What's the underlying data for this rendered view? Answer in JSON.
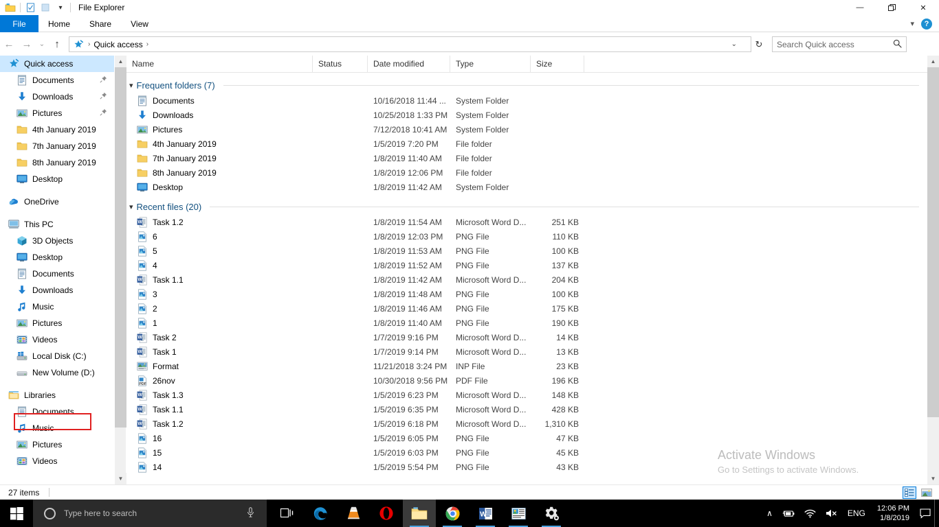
{
  "window": {
    "title": "File Explorer",
    "quick_access_toolbar": [
      "folder-icon",
      "properties-icon",
      "new-folder-icon",
      "customize-dropdown-icon"
    ],
    "controls": {
      "minimize": "—",
      "maximize": "❐",
      "close": "✕"
    }
  },
  "ribbon": {
    "tabs": [
      {
        "label": "File",
        "active": true
      },
      {
        "label": "Home",
        "active": false
      },
      {
        "label": "Share",
        "active": false
      },
      {
        "label": "View",
        "active": false
      }
    ],
    "collapse_icon": "chevron-down-icon",
    "help_label": "?"
  },
  "addressbar": {
    "back_icon": "←",
    "forward_icon": "→",
    "recent_icon": "⌄",
    "up_icon": "↑",
    "breadcrumb": [
      "Quick access"
    ],
    "breadcrumb_icon": "quick-access-star-icon",
    "separator": "›",
    "dropdown_icon": "⌄",
    "refresh_icon": "↻"
  },
  "search": {
    "placeholder": "Search Quick access",
    "value": "",
    "icon": "search-icon"
  },
  "sidebar": {
    "items": [
      {
        "label": "Quick access",
        "icon": "quick-access-star-icon",
        "indent": 0,
        "selected": true,
        "pinned": false,
        "gap_before": false
      },
      {
        "label": "Documents",
        "icon": "documents-icon",
        "indent": 1,
        "selected": false,
        "pinned": true,
        "gap_before": false
      },
      {
        "label": "Downloads",
        "icon": "downloads-icon",
        "indent": 1,
        "selected": false,
        "pinned": true,
        "gap_before": false
      },
      {
        "label": "Pictures",
        "icon": "pictures-icon",
        "indent": 1,
        "selected": false,
        "pinned": true,
        "gap_before": false
      },
      {
        "label": "4th January 2019",
        "icon": "folder-icon",
        "indent": 1,
        "selected": false,
        "pinned": false,
        "gap_before": false
      },
      {
        "label": "7th January 2019",
        "icon": "folder-icon",
        "indent": 1,
        "selected": false,
        "pinned": false,
        "gap_before": false
      },
      {
        "label": "8th January 2019",
        "icon": "folder-icon",
        "indent": 1,
        "selected": false,
        "pinned": false,
        "gap_before": false
      },
      {
        "label": "Desktop",
        "icon": "desktop-icon",
        "indent": 1,
        "selected": false,
        "pinned": false,
        "gap_before": false
      },
      {
        "label": "OneDrive",
        "icon": "onedrive-cloud-icon",
        "indent": 0,
        "selected": false,
        "pinned": false,
        "gap_before": true
      },
      {
        "label": "This PC",
        "icon": "this-pc-icon",
        "indent": 0,
        "selected": false,
        "pinned": false,
        "gap_before": true
      },
      {
        "label": "3D Objects",
        "icon": "3d-objects-icon",
        "indent": 1,
        "selected": false,
        "pinned": false,
        "gap_before": false
      },
      {
        "label": "Desktop",
        "icon": "desktop-icon",
        "indent": 1,
        "selected": false,
        "pinned": false,
        "gap_before": false
      },
      {
        "label": "Documents",
        "icon": "documents-icon",
        "indent": 1,
        "selected": false,
        "pinned": false,
        "gap_before": false
      },
      {
        "label": "Downloads",
        "icon": "downloads-icon",
        "indent": 1,
        "selected": false,
        "pinned": false,
        "gap_before": false
      },
      {
        "label": "Music",
        "icon": "music-note-icon",
        "indent": 1,
        "selected": false,
        "pinned": false,
        "gap_before": false
      },
      {
        "label": "Pictures",
        "icon": "pictures-icon",
        "indent": 1,
        "selected": false,
        "pinned": false,
        "gap_before": false
      },
      {
        "label": "Videos",
        "icon": "videos-icon",
        "indent": 1,
        "selected": false,
        "pinned": false,
        "gap_before": false
      },
      {
        "label": "Local Disk (C:)",
        "icon": "windows-drive-icon",
        "indent": 1,
        "selected": false,
        "pinned": false,
        "gap_before": false,
        "highlighted": true
      },
      {
        "label": "New Volume (D:)",
        "icon": "drive-icon",
        "indent": 1,
        "selected": false,
        "pinned": false,
        "gap_before": false
      },
      {
        "label": "Libraries",
        "icon": "libraries-icon",
        "indent": 0,
        "selected": false,
        "pinned": false,
        "gap_before": true
      },
      {
        "label": "Documents",
        "icon": "documents-icon",
        "indent": 1,
        "selected": false,
        "pinned": false,
        "gap_before": false
      },
      {
        "label": "Music",
        "icon": "music-note-icon",
        "indent": 1,
        "selected": false,
        "pinned": false,
        "gap_before": false
      },
      {
        "label": "Pictures",
        "icon": "pictures-icon",
        "indent": 1,
        "selected": false,
        "pinned": false,
        "gap_before": false
      },
      {
        "label": "Videos",
        "icon": "videos-icon",
        "indent": 1,
        "selected": false,
        "pinned": false,
        "gap_before": false
      }
    ]
  },
  "filelist": {
    "columns": [
      {
        "label": "Name"
      },
      {
        "label": "Status"
      },
      {
        "label": "Date modified"
      },
      {
        "label": "Type"
      },
      {
        "label": "Size"
      }
    ],
    "groups": [
      {
        "header": "Frequent folders (7)",
        "chevron": "⌄",
        "rows": [
          {
            "name": "Documents",
            "icon": "documents-icon",
            "date": "10/16/2018 11:44 ...",
            "type": "System Folder",
            "size": ""
          },
          {
            "name": "Downloads",
            "icon": "downloads-icon",
            "date": "10/25/2018 1:33 PM",
            "type": "System Folder",
            "size": ""
          },
          {
            "name": "Pictures",
            "icon": "pictures-icon",
            "date": "7/12/2018 10:41 AM",
            "type": "System Folder",
            "size": ""
          },
          {
            "name": "4th January 2019",
            "icon": "folder-icon",
            "date": "1/5/2019 7:20 PM",
            "type": "File folder",
            "size": ""
          },
          {
            "name": "7th January 2019",
            "icon": "folder-icon",
            "date": "1/8/2019 11:40 AM",
            "type": "File folder",
            "size": ""
          },
          {
            "name": "8th January 2019",
            "icon": "folder-icon",
            "date": "1/8/2019 12:06 PM",
            "type": "File folder",
            "size": ""
          },
          {
            "name": "Desktop",
            "icon": "desktop-icon",
            "date": "1/8/2019 11:42 AM",
            "type": "System Folder",
            "size": ""
          }
        ]
      },
      {
        "header": "Recent files (20)",
        "chevron": "⌄",
        "rows": [
          {
            "name": "Task 1.2",
            "icon": "word-doc-icon",
            "date": "1/8/2019 11:54 AM",
            "type": "Microsoft Word D...",
            "size": "251 KB"
          },
          {
            "name": "6",
            "icon": "png-file-icon",
            "date": "1/8/2019 12:03 PM",
            "type": "PNG File",
            "size": "110 KB"
          },
          {
            "name": "5",
            "icon": "png-file-icon",
            "date": "1/8/2019 11:53 AM",
            "type": "PNG File",
            "size": "100 KB"
          },
          {
            "name": "4",
            "icon": "png-file-icon",
            "date": "1/8/2019 11:52 AM",
            "type": "PNG File",
            "size": "137 KB"
          },
          {
            "name": "Task 1.1",
            "icon": "word-doc-icon",
            "date": "1/8/2019 11:42 AM",
            "type": "Microsoft Word D...",
            "size": "204 KB"
          },
          {
            "name": "3",
            "icon": "png-file-icon",
            "date": "1/8/2019 11:48 AM",
            "type": "PNG File",
            "size": "100 KB"
          },
          {
            "name": "2",
            "icon": "png-file-icon",
            "date": "1/8/2019 11:46 AM",
            "type": "PNG File",
            "size": "175 KB"
          },
          {
            "name": "1",
            "icon": "png-file-icon",
            "date": "1/8/2019 11:40 AM",
            "type": "PNG File",
            "size": "190 KB"
          },
          {
            "name": "Task 2",
            "icon": "word-doc-icon",
            "date": "1/7/2019 9:16 PM",
            "type": "Microsoft Word D...",
            "size": "14 KB"
          },
          {
            "name": "Task 1",
            "icon": "word-doc-icon",
            "date": "1/7/2019 9:14 PM",
            "type": "Microsoft Word D...",
            "size": "13 KB"
          },
          {
            "name": "Format",
            "icon": "inp-file-icon",
            "date": "11/21/2018 3:24 PM",
            "type": "INP File",
            "size": "23 KB"
          },
          {
            "name": "26nov",
            "icon": "pdf-file-icon",
            "date": "10/30/2018 9:56 PM",
            "type": "PDF File",
            "size": "196 KB"
          },
          {
            "name": "Task 1.3",
            "icon": "word-doc-icon",
            "date": "1/5/2019 6:23 PM",
            "type": "Microsoft Word D...",
            "size": "148 KB"
          },
          {
            "name": "Task 1.1",
            "icon": "word-doc-icon",
            "date": "1/5/2019 6:35 PM",
            "type": "Microsoft Word D...",
            "size": "428 KB"
          },
          {
            "name": "Task 1.2",
            "icon": "word-doc-icon",
            "date": "1/5/2019 6:18 PM",
            "type": "Microsoft Word D...",
            "size": "1,310 KB"
          },
          {
            "name": "16",
            "icon": "png-file-icon",
            "date": "1/5/2019 6:05 PM",
            "type": "PNG File",
            "size": "47 KB"
          },
          {
            "name": "15",
            "icon": "png-file-icon",
            "date": "1/5/2019 6:03 PM",
            "type": "PNG File",
            "size": "45 KB"
          },
          {
            "name": "14",
            "icon": "png-file-icon",
            "date": "1/5/2019 5:54 PM",
            "type": "PNG File",
            "size": "43 KB"
          }
        ]
      }
    ]
  },
  "watermark": {
    "line1": "Activate Windows",
    "line2": "Go to Settings to activate Windows."
  },
  "statusbar": {
    "item_count": "27 items",
    "views": [
      {
        "name": "details-view",
        "active": true
      },
      {
        "name": "large-icons-view",
        "active": false
      }
    ]
  },
  "taskbar": {
    "start_label": "start-button",
    "search_placeholder": "Type here to search",
    "search_value": "",
    "cortana_icon": "cortana-circle-icon",
    "mic_icon": "microphone-icon",
    "apps": [
      {
        "name": "task-view",
        "icon": "task-view-icon",
        "running": false,
        "active": false
      },
      {
        "name": "microsoft-edge",
        "icon": "edge-icon",
        "running": false,
        "active": false
      },
      {
        "name": "vlc-media-player",
        "icon": "vlc-cone-icon",
        "running": false,
        "active": false
      },
      {
        "name": "opera-browser",
        "icon": "opera-icon",
        "running": false,
        "active": false
      },
      {
        "name": "file-explorer",
        "icon": "file-explorer-icon",
        "running": true,
        "active": true
      },
      {
        "name": "google-chrome",
        "icon": "chrome-icon",
        "running": true,
        "active": false
      },
      {
        "name": "microsoft-word",
        "icon": "word-icon",
        "running": true,
        "active": false
      },
      {
        "name": "microsoft-publisher",
        "icon": "publisher-icon",
        "running": true,
        "active": false
      },
      {
        "name": "settings",
        "icon": "settings-gear-icon",
        "running": true,
        "active": false
      }
    ],
    "tray": {
      "overflow_icon": "∧",
      "battery_icon": "battery-charging-icon",
      "network_icon": "wifi-icon",
      "volume_icon": "volume-muted-icon",
      "language": "ENG",
      "time": "12:06 PM",
      "date": "1/8/2019",
      "notification_icon": "action-center-icon"
    }
  },
  "colors": {
    "accent": "#0078d7",
    "selection": "#cce8ff",
    "group_header": "#12507f",
    "annotation_red": "#e02020",
    "taskbar": "#000000"
  }
}
